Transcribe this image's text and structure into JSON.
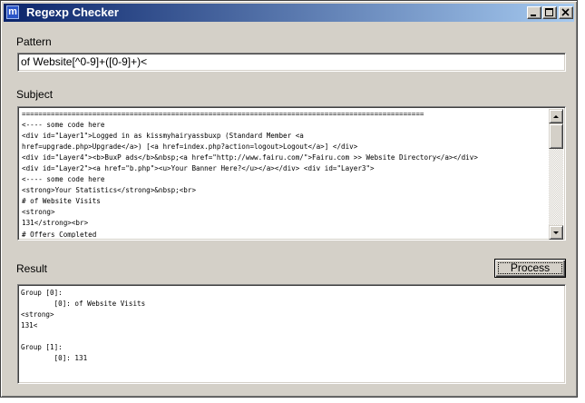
{
  "window": {
    "title": "Regexp Checker",
    "icon_letter": "m",
    "controls": {
      "minimize": "minimize-icon",
      "maximize": "maximize-icon",
      "close": "close-icon"
    }
  },
  "pattern": {
    "label": "Pattern",
    "value": "of Website[^0-9]+([0-9]+)<"
  },
  "subject": {
    "label": "Subject",
    "lines": [
      "=================================================================================================",
      "<---- some code here",
      "<div id=\"Layer1\">Logged in as kissmyhairyassbuxp (Standard Member <a",
      "href=upgrade.php>Upgrade</a>) [<a href=index.php?action=logout>Logout</a>] </div>",
      "<div id=\"Layer4\"><b>BuxP ads</b>&nbsp;<a href=\"http://www.fairu.com/\">Fairu.com >> Website Directory</a></div>",
      "<div id=\"Layer2\"><a href=\"b.php\"><u>Your Banner Here?</u></a></div> <div id=\"Layer3\">",
      "<---- some code here",
      "<strong>Your Statistics</strong>&nbsp;<br>",
      "# of Website Visits",
      "<strong>",
      "131</strong><br>",
      "# Offers Completed"
    ]
  },
  "result": {
    "label": "Result",
    "button_label": "Process",
    "lines": [
      "Group [0]:",
      "        [0]: of Website Visits",
      "<strong>",
      "131<",
      "",
      "Group [1]:",
      "        [0]: 131"
    ]
  },
  "colors": {
    "titlebar_start": "#0a246a",
    "titlebar_end": "#a6caf0",
    "face": "#d4d0c8"
  }
}
